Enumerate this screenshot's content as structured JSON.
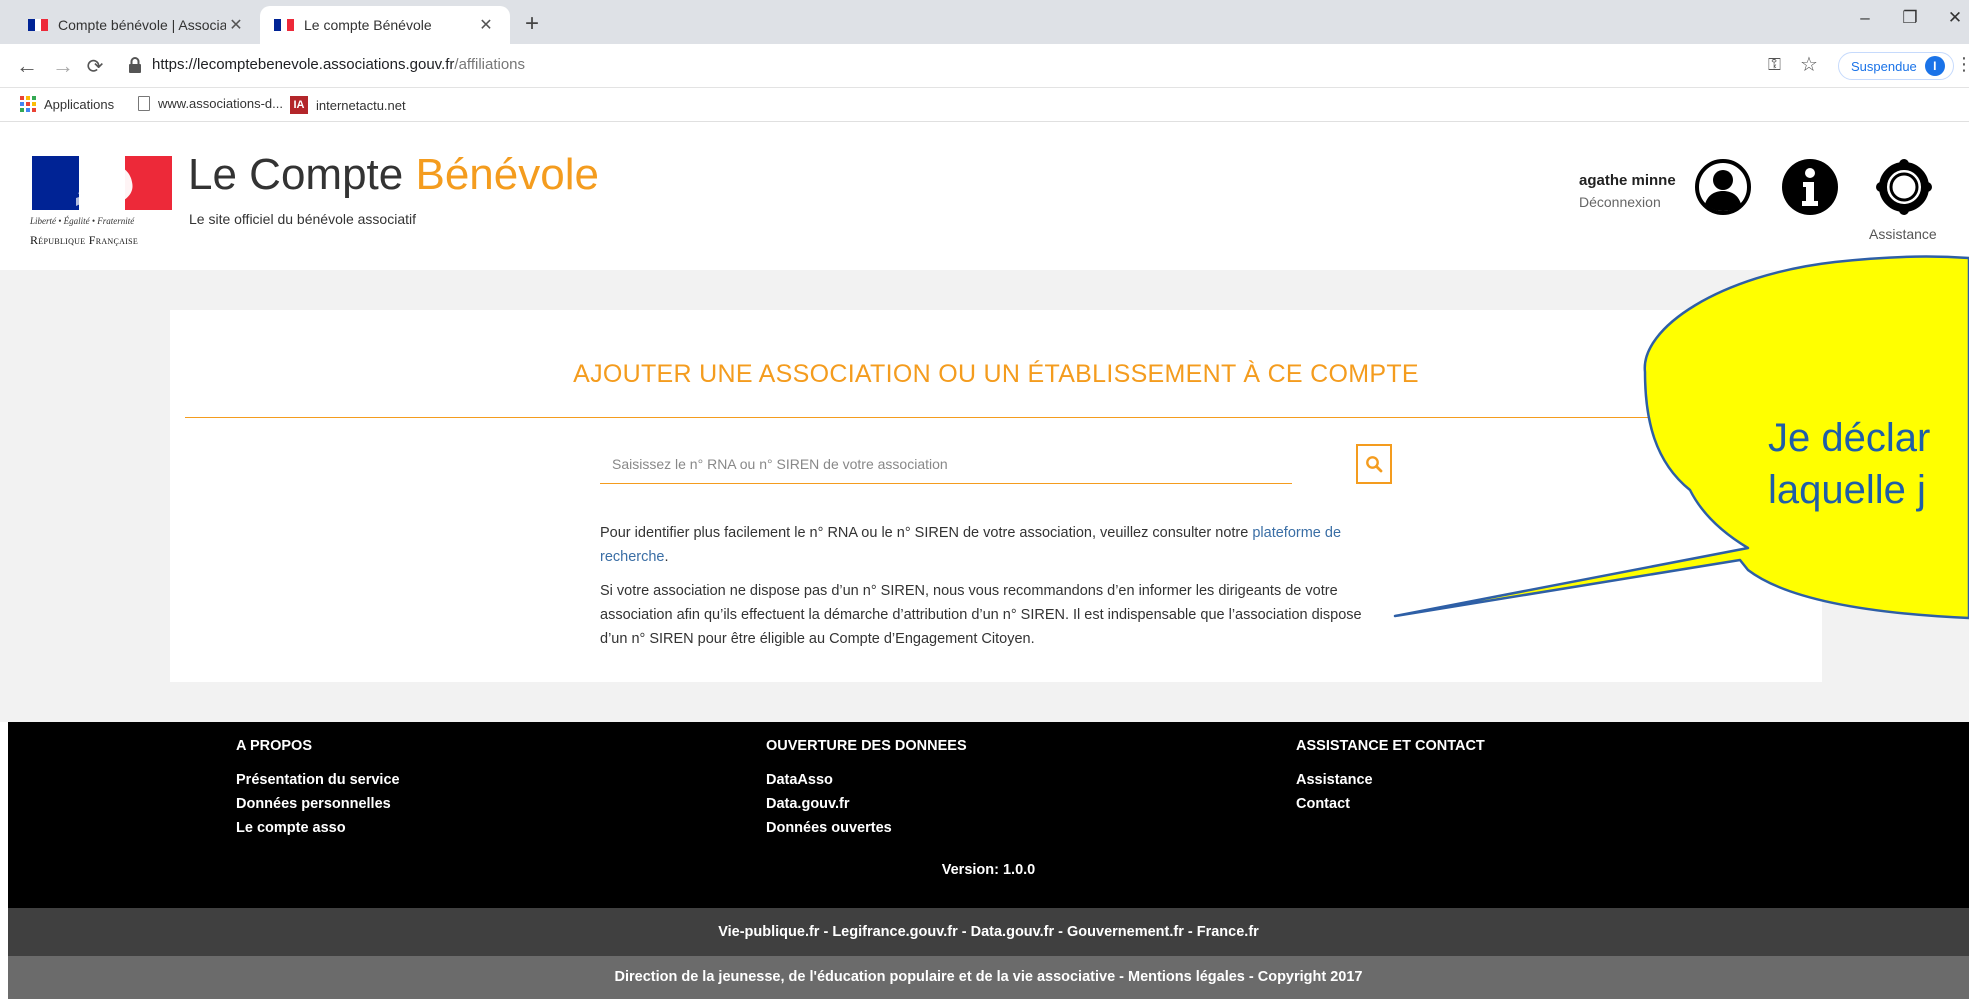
{
  "browser": {
    "tabs": [
      {
        "title": "Compte bénévole | Associations.",
        "active": false
      },
      {
        "title": "Le compte Bénévole",
        "active": true
      }
    ],
    "url_host": "https://lecomptebenevole.associations.gouv.fr",
    "url_path": "/affiliations",
    "profile_label": "Suspendue",
    "profile_initial": "I",
    "bookmarks": [
      "Applications",
      "www.associations-d...",
      "internetactu.net"
    ],
    "bookmark_icon_text": "IA"
  },
  "header": {
    "brand_prefix": "Le Compte ",
    "brand_accent": "Bénévole",
    "subtitle": "Le site officiel du bénévole associatif",
    "motto": "Liberté • Égalité • Fraternité",
    "republic": "République Française",
    "user_name": "agathe minne",
    "logout": "Déconnexion",
    "assistance_label": "Assistance"
  },
  "main": {
    "title": "AJOUTER UNE ASSOCIATION OU UN ÉTABLISSEMENT À CE COMPTE",
    "search_placeholder": "Saisissez le n° RNA ou n° SIREN de votre association",
    "para1_text": "Pour identifier plus facilement le n° RNA ou le n° SIREN de votre association, veuillez consulter notre ",
    "para1_link": "plateforme de recherche",
    "para1_end": ".",
    "para2": "Si votre association ne dispose pas d’un n° SIREN, nous vous recommandons d’en informer  les dirigeants de votre association afin qu’ils effectuent la démarche d’attribution d’un n° SIREN. Il est indispensable que l’association dispose d’un n° SIREN pour être éligible au Compte d’Engagement Citoyen."
  },
  "footer": {
    "columns": [
      {
        "heading": "A PROPOS",
        "links": [
          "Présentation du service",
          "Données personnelles",
          "Le compte asso"
        ]
      },
      {
        "heading": "OUVERTURE DES DONNEES",
        "links": [
          "DataAsso",
          "Data.gouv.fr",
          "Données ouvertes"
        ]
      },
      {
        "heading": "ASSISTANCE ET CONTACT",
        "links": [
          "Assistance",
          "Contact"
        ]
      }
    ],
    "version": "Version: 1.0.0",
    "links_bar": "Vie-publique.fr - Legifrance.gouv.fr - Data.gouv.fr - Gouvernement.fr - France.fr",
    "legal_bar": "Direction de la jeunesse, de l'éducation populaire et de la vie associative - Mentions légales - Copyright 2017"
  },
  "callout": {
    "line1": "Je déclar",
    "line2": "laquelle j"
  },
  "colors": {
    "accent": "#f49c1e",
    "link": "#3a6ea5",
    "callout_fill": "#ffff00",
    "callout_stroke": "#2e5fa6",
    "flag_blue": "#002395",
    "flag_red": "#ed2939"
  }
}
